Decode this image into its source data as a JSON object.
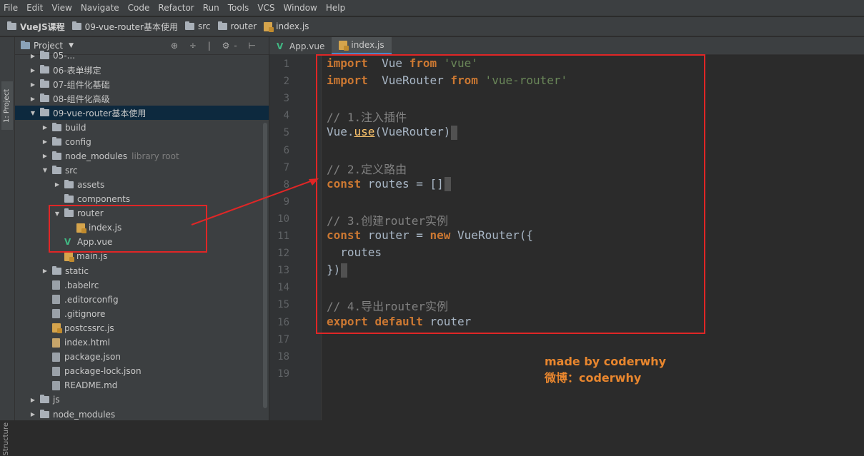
{
  "menu": [
    "File",
    "Edit",
    "View",
    "Navigate",
    "Code",
    "Refactor",
    "Run",
    "Tools",
    "VCS",
    "Window",
    "Help"
  ],
  "breadcrumb": [
    "VueJS课程",
    "09-vue-router基本使用",
    "src",
    "router",
    "index.js"
  ],
  "toolwindow": {
    "project_tab": "1: Project",
    "structure_tab": "Structure"
  },
  "project_panel": {
    "title": "Project",
    "tools": "⊕ ÷ | ⚙- ⊢"
  },
  "tree": [
    {
      "label": "05-...",
      "type": "folder",
      "depth": 1,
      "open": false,
      "muted": ""
    },
    {
      "label": "06-表单绑定",
      "type": "folder",
      "depth": 1,
      "open": false,
      "muted": ""
    },
    {
      "label": "07-组件化基础",
      "type": "folder",
      "depth": 1,
      "open": false,
      "muted": ""
    },
    {
      "label": "08-组件化高级",
      "type": "folder",
      "depth": 1,
      "open": false,
      "muted": ""
    },
    {
      "label": "09-vue-router基本使用",
      "type": "folder",
      "depth": 1,
      "open": true,
      "muted": "",
      "selected": true
    },
    {
      "label": "build",
      "type": "folder",
      "depth": 2,
      "open": false,
      "muted": ""
    },
    {
      "label": "config",
      "type": "folder",
      "depth": 2,
      "open": false,
      "muted": ""
    },
    {
      "label": "node_modules",
      "type": "folder",
      "depth": 2,
      "open": false,
      "muted": "library root"
    },
    {
      "label": "src",
      "type": "folder",
      "depth": 2,
      "open": true,
      "muted": ""
    },
    {
      "label": "assets",
      "type": "folder",
      "depth": 3,
      "open": false,
      "muted": ""
    },
    {
      "label": "components",
      "type": "folder",
      "depth": 3,
      "leaf": true,
      "muted": ""
    },
    {
      "label": "router",
      "type": "folder",
      "depth": 3,
      "open": true,
      "muted": ""
    },
    {
      "label": "index.js",
      "type": "js",
      "depth": 4,
      "muted": ""
    },
    {
      "label": "App.vue",
      "type": "vue",
      "depth": 3,
      "muted": ""
    },
    {
      "label": "main.js",
      "type": "js",
      "depth": 3,
      "muted": ""
    },
    {
      "label": "static",
      "type": "folder",
      "depth": 2,
      "open": false,
      "muted": ""
    },
    {
      "label": ".babelrc",
      "type": "file",
      "depth": 2,
      "muted": ""
    },
    {
      "label": ".editorconfig",
      "type": "file",
      "depth": 2,
      "muted": ""
    },
    {
      "label": ".gitignore",
      "type": "file",
      "depth": 2,
      "muted": ""
    },
    {
      "label": "postcssrc.js",
      "type": "js",
      "depth": 2,
      "muted": ""
    },
    {
      "label": "index.html",
      "type": "html",
      "depth": 2,
      "muted": ""
    },
    {
      "label": "package.json",
      "type": "file",
      "depth": 2,
      "muted": ""
    },
    {
      "label": "package-lock.json",
      "type": "file",
      "depth": 2,
      "muted": ""
    },
    {
      "label": "README.md",
      "type": "file",
      "depth": 2,
      "muted": ""
    },
    {
      "label": "js",
      "type": "folder",
      "depth": 1,
      "open": false,
      "muted": ""
    },
    {
      "label": "node_modules",
      "type": "folder",
      "depth": 1,
      "open": false,
      "muted": ""
    }
  ],
  "editor_tabs": [
    {
      "label": "App.vue",
      "type": "vue",
      "active": false
    },
    {
      "label": "index.js",
      "type": "js",
      "active": true
    }
  ],
  "code_lines": [
    [
      [
        "kw",
        "import"
      ],
      [
        "",
        "  Vue "
      ],
      [
        "kw",
        "from"
      ],
      [
        "str",
        " 'vue'"
      ]
    ],
    [
      [
        "kw",
        "import"
      ],
      [
        "",
        "  VueRouter "
      ],
      [
        "kw",
        "from"
      ],
      [
        "str",
        " 'vue-router'"
      ]
    ],
    [],
    [
      [
        "com",
        "// 1.注入插件"
      ]
    ],
    [
      [
        "",
        "Vue."
      ],
      [
        "fn",
        "use"
      ],
      [
        "",
        "(VueRouter)"
      ],
      [
        "cur",
        ""
      ]
    ],
    [],
    [
      [
        "com",
        "// 2.定义路由"
      ]
    ],
    [
      [
        "kw",
        "const"
      ],
      [
        "",
        " routes = []"
      ],
      [
        "cur",
        ""
      ]
    ],
    [],
    [
      [
        "com",
        "// 3.创建router实例"
      ]
    ],
    [
      [
        "kw",
        "const"
      ],
      [
        "",
        " router = "
      ],
      [
        "kw",
        "new"
      ],
      [
        "",
        " VueRouter({"
      ]
    ],
    [
      [
        "",
        "  routes"
      ]
    ],
    [
      [
        "",
        "})"
      ],
      [
        "cur",
        ""
      ]
    ],
    [],
    [
      [
        "com",
        "// 4.导出router实例"
      ]
    ],
    [
      [
        "kw",
        "export"
      ],
      [
        "",
        " "
      ],
      [
        "kw",
        "default"
      ],
      [
        "",
        " router"
      ]
    ],
    [],
    [],
    []
  ],
  "caption": {
    "line1": "made by coderwhy",
    "line2": "微博：coderwhy"
  },
  "colors": {
    "annotation_red": "#e02626",
    "caption_orange": "#e8862e",
    "keyword": "#cc7832",
    "string": "#6a8759",
    "comment": "#808080"
  }
}
